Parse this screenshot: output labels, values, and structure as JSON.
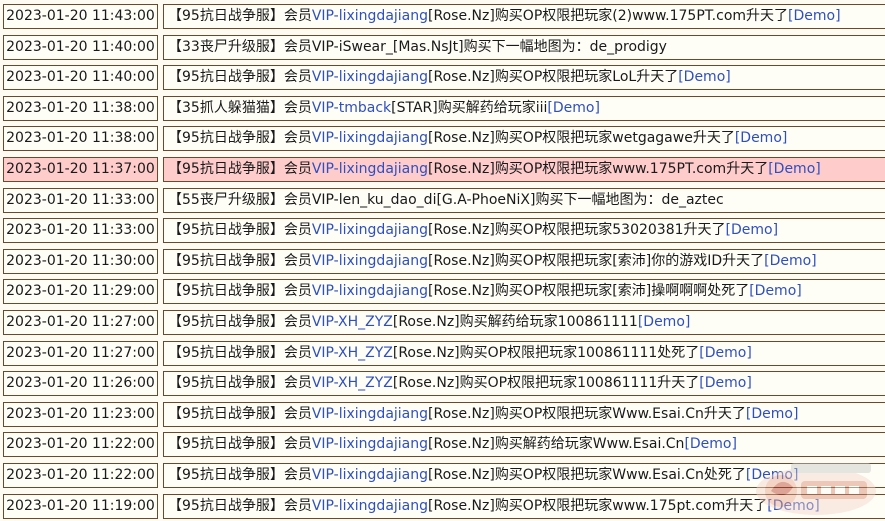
{
  "rows": [
    {
      "time": "2023-01-20 11:43:00",
      "server": "【95抗日战争服】",
      "member": "会员",
      "vip": "VIP-lixingdajiang",
      "tag": "[Rose.Nz]",
      "action": "购买OP权限把玩家(2)www.175PT.com升天了",
      "demo": "[Demo]",
      "highlight": false
    },
    {
      "time": "2023-01-20 11:40:00",
      "server": "【33丧尸升级服】",
      "member": "会员VIP-iSwear_[Mas.NsJt]",
      "vip": "",
      "tag": "",
      "action": "购买下一幅地图为：de_prodigy",
      "demo": "",
      "highlight": false
    },
    {
      "time": "2023-01-20 11:40:00",
      "server": "【95抗日战争服】",
      "member": "会员",
      "vip": "VIP-lixingdajiang",
      "tag": "[Rose.Nz]",
      "action": "购买OP权限把玩家LoL升天了",
      "demo": "[Demo]",
      "highlight": false
    },
    {
      "time": "2023-01-20 11:38:00",
      "server": "【35抓人躲猫猫】",
      "member": "会员",
      "vip": "VIP-tmback",
      "tag": "[STAR]",
      "action": "购买解药给玩家iii",
      "demo": "[Demo]",
      "highlight": false
    },
    {
      "time": "2023-01-20 11:38:00",
      "server": "【95抗日战争服】",
      "member": "会员",
      "vip": "VIP-lixingdajiang",
      "tag": "[Rose.Nz]",
      "action": "购买OP权限把玩家wetgagawe升天了",
      "demo": "[Demo]",
      "highlight": false
    },
    {
      "time": "2023-01-20 11:37:00",
      "server": "【95抗日战争服】",
      "member": "会员",
      "vip": "VIP-lixingdajiang",
      "tag": "[Rose.Nz]",
      "action": "购买OP权限把玩家www.175PT.com升天了",
      "demo": "[Demo]",
      "highlight": true
    },
    {
      "time": "2023-01-20 11:33:00",
      "server": "【55丧尸升级服】",
      "member": "会员VIP-len_ku_dao_di[G.A-PhoeNiX]",
      "vip": "",
      "tag": "",
      "action": "购买下一幅地图为：de_aztec",
      "demo": "",
      "highlight": false
    },
    {
      "time": "2023-01-20 11:33:00",
      "server": "【95抗日战争服】",
      "member": "会员",
      "vip": "VIP-lixingdajiang",
      "tag": "[Rose.Nz]",
      "action": "购买OP权限把玩家53020381升天了",
      "demo": "[Demo]",
      "highlight": false
    },
    {
      "time": "2023-01-20 11:30:00",
      "server": "【95抗日战争服】",
      "member": "会员",
      "vip": "VIP-lixingdajiang",
      "tag": "[Rose.Nz]",
      "action": "购买OP权限把玩家[索沛]你的游戏ID升天了",
      "demo": "[Demo]",
      "highlight": false
    },
    {
      "time": "2023-01-20 11:29:00",
      "server": "【95抗日战争服】",
      "member": "会员",
      "vip": "VIP-lixingdajiang",
      "tag": "[Rose.Nz]",
      "action": "购买OP权限把玩家[索沛]操啊啊啊处死了",
      "demo": "[Demo]",
      "highlight": false
    },
    {
      "time": "2023-01-20 11:27:00",
      "server": "【95抗日战争服】",
      "member": "会员",
      "vip": "VIP-XH_ZYZ",
      "tag": "[Rose.Nz]",
      "action": "购买解药给玩家100861111",
      "demo": "[Demo]",
      "highlight": false
    },
    {
      "time": "2023-01-20 11:27:00",
      "server": "【95抗日战争服】",
      "member": "会员",
      "vip": "VIP-XH_ZYZ",
      "tag": "[Rose.Nz]",
      "action": "购买OP权限把玩家100861111处死了",
      "demo": "[Demo]",
      "highlight": false
    },
    {
      "time": "2023-01-20 11:26:00",
      "server": "【95抗日战争服】",
      "member": "会员",
      "vip": "VIP-XH_ZYZ",
      "tag": "[Rose.Nz]",
      "action": "购买OP权限把玩家100861111升天了",
      "demo": "[Demo]",
      "highlight": false
    },
    {
      "time": "2023-01-20 11:23:00",
      "server": "【95抗日战争服】",
      "member": "会员",
      "vip": "VIP-lixingdajiang",
      "tag": "[Rose.Nz]",
      "action": "购买OP权限把玩家Www.Esai.Cn升天了",
      "demo": "[Demo]",
      "highlight": false
    },
    {
      "time": "2023-01-20 11:22:00",
      "server": "【95抗日战争服】",
      "member": "会员",
      "vip": "VIP-lixingdajiang",
      "tag": "[Rose.Nz]",
      "action": "购买解药给玩家Www.Esai.Cn",
      "demo": "[Demo]",
      "highlight": false
    },
    {
      "time": "2023-01-20 11:22:00",
      "server": "【95抗日战争服】",
      "member": "会员",
      "vip": "VIP-lixingdajiang",
      "tag": "[Rose.Nz]",
      "action": "购买OP权限把玩家Www.Esai.Cn处死了",
      "demo": "[Demo]",
      "highlight": false
    },
    {
      "time": "2023-01-20 11:19:00",
      "server": "【95抗日战争服】",
      "member": "会员",
      "vip": "VIP-lixingdajiang",
      "tag": "[Rose.Nz]",
      "action": "购买OP权限把玩家www.175pt.com升天了",
      "demo": "[Demo]",
      "highlight": false
    }
  ],
  "colors": {
    "border": "#6B4A2C",
    "cell_bg": "#FFFEF6",
    "highlight_bg": "#FFCCCC",
    "link": "#2E4FC0",
    "text": "#1A1A1A"
  },
  "watermark_icon": "site-logo-watermark-icon"
}
